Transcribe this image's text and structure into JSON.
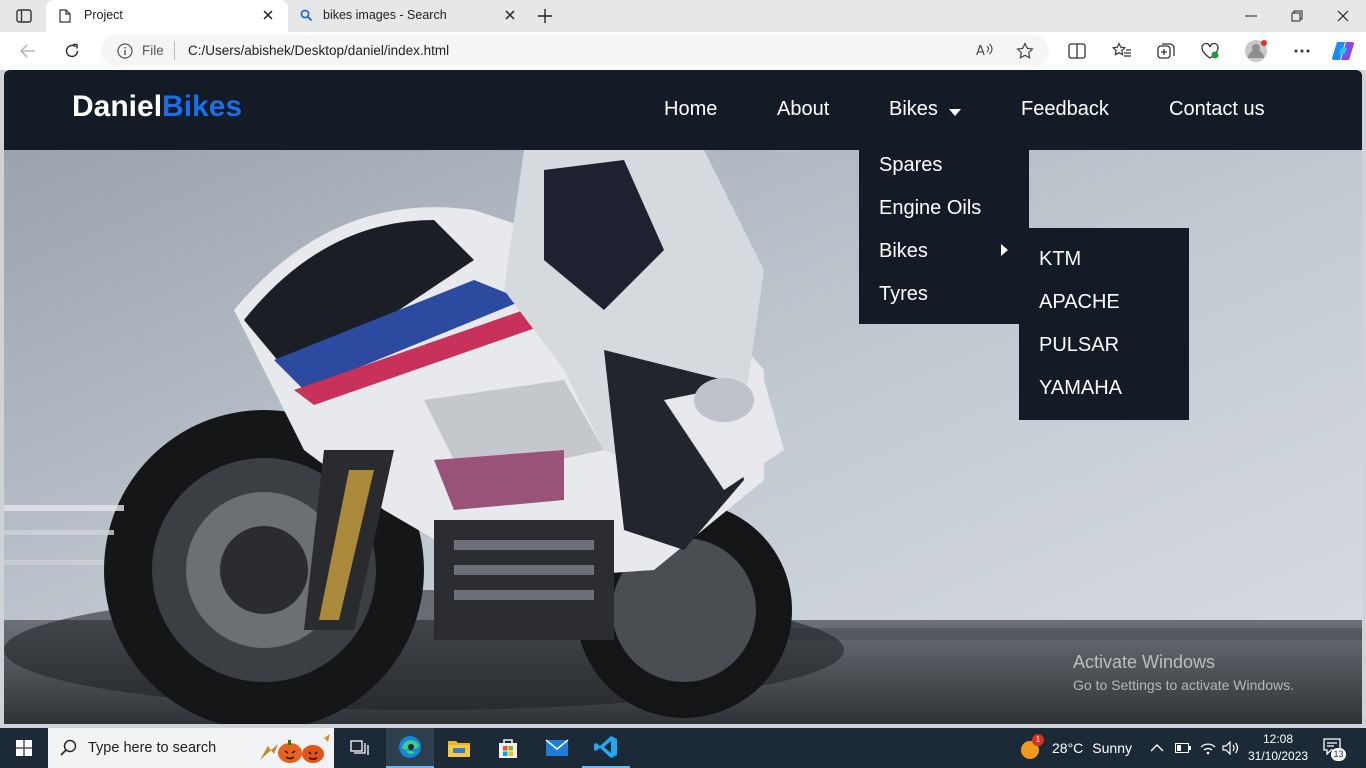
{
  "browser": {
    "tabs": [
      {
        "title": "Project"
      },
      {
        "title": "bikes images - Search"
      }
    ],
    "address": {
      "scheme_label": "File",
      "url": "C:/Users/abishek/Desktop/daniel/index.html"
    }
  },
  "site": {
    "logo_primary": "Daniel",
    "logo_accent": "Bikes",
    "nav": {
      "home": "Home",
      "about": "About",
      "bikes": "Bikes",
      "feedback": "Feedback",
      "contact": "Contact us"
    },
    "bikes_menu": {
      "spares": "Spares",
      "engine_oils": "Engine Oils",
      "bikes": "Bikes",
      "tyres": "Tyres"
    },
    "bikes_submenu": {
      "ktm": "KTM",
      "apache": "APACHE",
      "pulsar": "PULSAR",
      "yamaha": "YAMAHA"
    },
    "colors": {
      "navbar": "#131b26",
      "logo_accent": "#1b6ee6"
    }
  },
  "watermark": {
    "title": "Activate Windows",
    "subtitle": "Go to Settings to activate Windows."
  },
  "taskbar": {
    "search_placeholder": "Type here to search",
    "weather": {
      "temp": "28°C",
      "condition": "Sunny",
      "badge": "1"
    },
    "clock": {
      "time": "12:08",
      "date": "31/10/2023"
    },
    "notifications": "13"
  }
}
